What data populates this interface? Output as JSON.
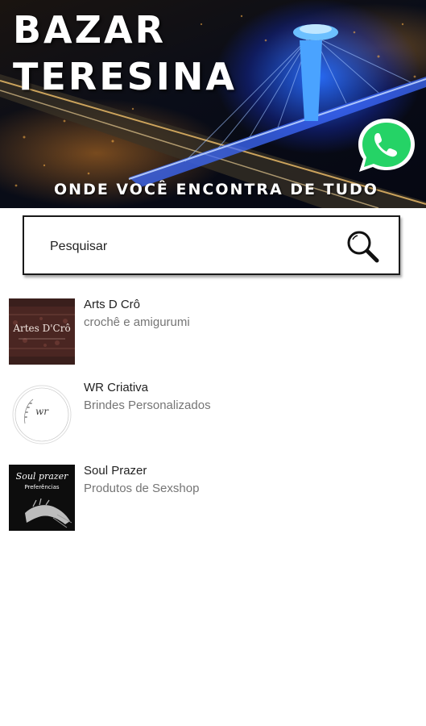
{
  "banner": {
    "title_line1": "BAZAR",
    "title_line2": "TERESINA",
    "tagline": "ONDE VOCÊ ENCONTRA DE TUDO",
    "whatsapp_icon": "whatsapp-icon"
  },
  "search": {
    "placeholder": "Pesquisar",
    "icon": "search-icon"
  },
  "stores": [
    {
      "name": "Arts D Crô",
      "description": "crochê e amigurumi",
      "logo_text": "Artes D'Crô"
    },
    {
      "name": "WR Criativa",
      "description": "Brindes Personalizados",
      "logo_text": "wr"
    },
    {
      "name": "Soul Prazer",
      "description": "Produtos de Sexshop",
      "logo_text": "Soul prazer",
      "logo_subtext": "Preferências"
    }
  ],
  "colors": {
    "whatsapp_green": "#25D366",
    "bridge_blue": "#2f7dff"
  }
}
